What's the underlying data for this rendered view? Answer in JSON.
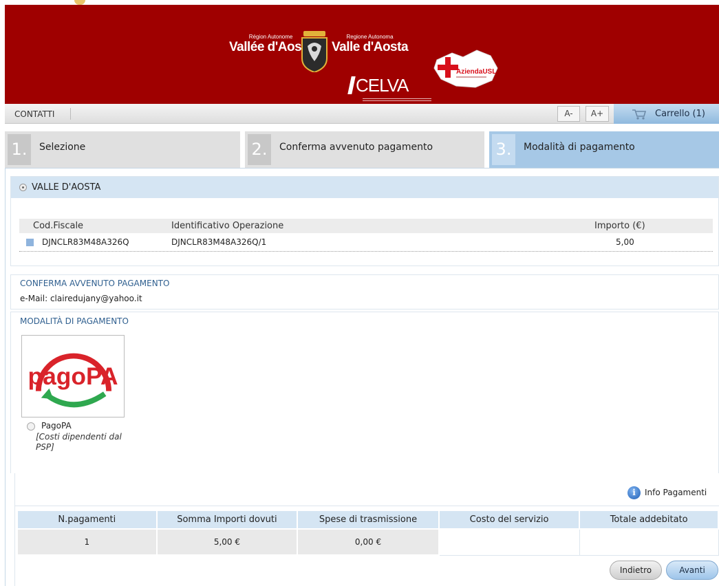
{
  "header": {
    "logo_left_small": "Région Autonome",
    "logo_left_big": "Vallée d'Aoste",
    "logo_right_small": "Regione Autonoma",
    "logo_right_big": "Valle d'Aosta",
    "celva": "CELVA",
    "usl_text": "AziendaUSL",
    "brand_red": "#9f0000"
  },
  "navbar": {
    "contatti": "CONTATTI",
    "font_minus": "A-",
    "font_plus": "A+",
    "cart": "Carrello (1)",
    "cart_icon": "cart-icon"
  },
  "steps": [
    {
      "num": "1.",
      "label": "Selezione"
    },
    {
      "num": "2.",
      "label": "Conferma avvenuto pagamento"
    },
    {
      "num": "3.",
      "label": "Modalità di pagamento"
    }
  ],
  "region": {
    "label": "VALLE D'AOSTA",
    "columns": [
      "Cod.Fiscale",
      "Identificativo Operazione",
      "Importo (€)"
    ],
    "rows": [
      {
        "cf": "DJNCLR83M48A326Q",
        "op": "DJNCLR83M48A326Q/1",
        "importo": "5,00"
      }
    ]
  },
  "confirm": {
    "title": "CONFERMA AVVENUTO PAGAMENTO",
    "email": "e-Mail: clairedujany@yahoo.it"
  },
  "payment": {
    "title": "MODALITÀ DI PAGAMENTO",
    "logo_text": "pagoPA",
    "option_name": "PagoPA",
    "option_note": "[Costi dipendenti dal PSP]"
  },
  "info": {
    "icon": "info-icon",
    "label": "Info Pagamenti"
  },
  "summary": {
    "headers": [
      "N.pagamenti",
      "Somma Importi dovuti",
      "Spese di trasmissione",
      "Costo del servizio",
      "Totale addebitato"
    ],
    "values": [
      "1",
      "5,00 €",
      "0,00 €",
      "",
      ""
    ]
  },
  "buttons": {
    "back": "Indietro",
    "next": "Avanti"
  }
}
